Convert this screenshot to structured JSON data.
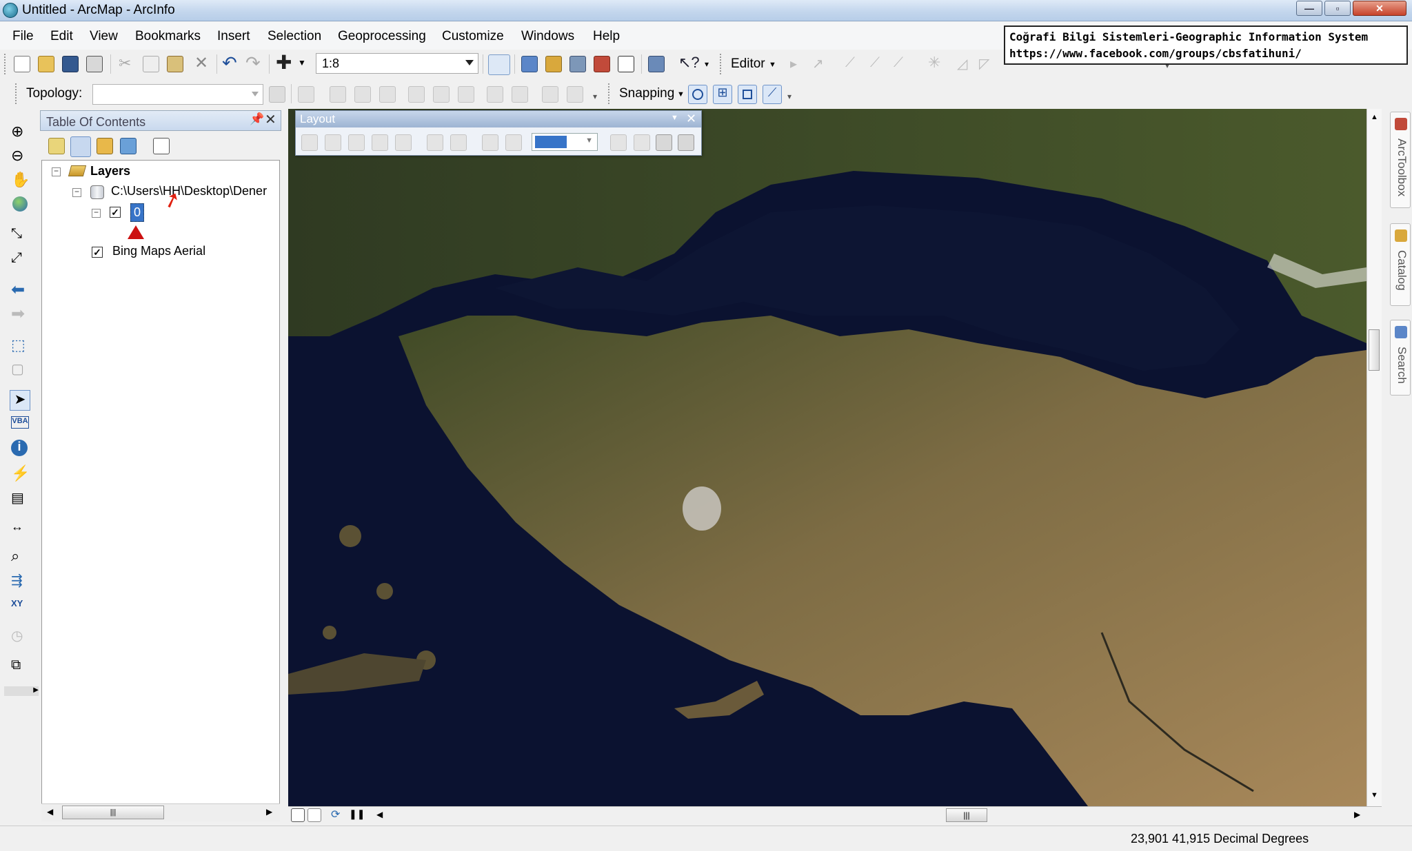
{
  "window": {
    "title": "Untitled - ArcMap - ArcInfo"
  },
  "menu": [
    "File",
    "Edit",
    "View",
    "Bookmarks",
    "Insert",
    "Selection",
    "Geoprocessing",
    "Customize",
    "Windows",
    "Help"
  ],
  "banner": {
    "line1": "Coğrafi Bilgi Sistemleri-Geographic Information System",
    "line2": "https://www.facebook.com/groups/cbsfatihuni/"
  },
  "standard_toolbar": {
    "scale_value": "1:8",
    "editor_label": "Editor"
  },
  "topology_toolbar": {
    "label": "Topology:",
    "value": "",
    "snapping_label": "Snapping"
  },
  "toc": {
    "title": "Table Of Contents",
    "layers_label": "Layers",
    "datasource_label": "C:\\Users\\HH\\Desktop\\Dener",
    "feature_layer_label": "0",
    "basemap_label": "Bing Maps Aerial"
  },
  "layout_toolbar": {
    "title": "Layout"
  },
  "right_dock": {
    "tabs": [
      "ArcToolbox",
      "Catalog",
      "Search"
    ]
  },
  "status": {
    "coordinates": "23,901  41,915 Decimal Degrees"
  },
  "colors": {
    "water": "#0b1230",
    "land": "#7a6a44",
    "accent": "#3774c8",
    "marker": "#cc1111"
  }
}
